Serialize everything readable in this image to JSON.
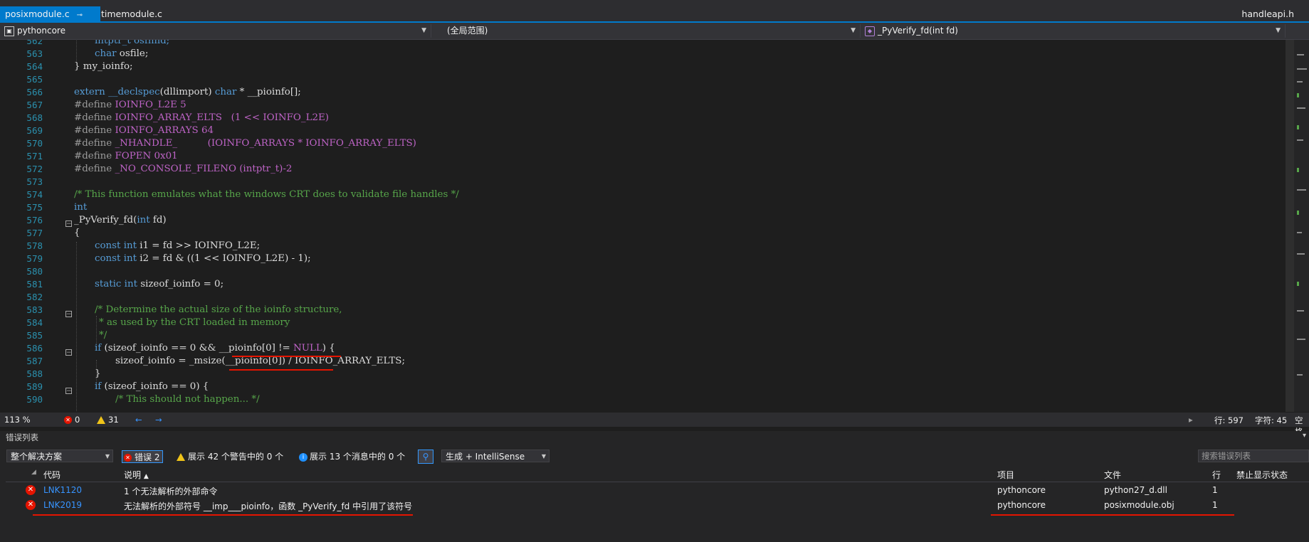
{
  "tabs": {
    "active": "posixmodule.c",
    "second": "timemodule.c",
    "right": "handleapi.h",
    "pin_glyph": "⊸",
    "close_glyph": "✕"
  },
  "navbar": {
    "project": "pythoncore",
    "scope": "(全局范围)",
    "member": "_PyVerify_fd(int fd)"
  },
  "editor": {
    "line_numbers": [
      "562",
      "563",
      "564",
      "565",
      "566",
      "567",
      "568",
      "569",
      "570",
      "571",
      "572",
      "573",
      "574",
      "575",
      "576",
      "577",
      "578",
      "579",
      "580",
      "581",
      "582",
      "583",
      "584",
      "585",
      "586",
      "587",
      "588",
      "589",
      "590"
    ],
    "code": {
      "l562": "intptr_t osfhnd;",
      "l563a": "char",
      "l563b": " osfile;",
      "l564": "} my_ioinfo;",
      "l566a": "extern",
      "l566b": "__declspec",
      "l566c": "(dllimport)",
      "l566d": "char",
      "l566e": " * __pioinfo[];",
      "define": "#define",
      "l567": "IOINFO_L2E 5",
      "l568a": "IOINFO_ARRAY_ELTS",
      "l568b": "(1 << IOINFO_L2E)",
      "l569": "IOINFO_ARRAYS 64",
      "l570a": "_NHANDLE_",
      "l570b": "(IOINFO_ARRAYS * IOINFO_ARRAY_ELTS)",
      "l571": "FOPEN 0x01",
      "l572a": "_NO_CONSOLE_FILENO",
      "l572b": " (intptr_t)-2",
      "l574": "/* This function emulates what the windows CRT does to validate file handles */",
      "l575": "int",
      "l576a": "_PyVerify_fd",
      "l576b": "(",
      "l576c": "int",
      "l576d": " fd)",
      "l577": "{",
      "const_int": "const int",
      "l578": " i1 = fd >> IOINFO_L2E;",
      "l579": " i2 = fd & ((1 << IOINFO_L2E) - 1);",
      "static_int": "static int",
      "l581": " sizeof_ioinfo = 0;",
      "l583": "/* Determine the actual size of the ioinfo structure,",
      "l584": "* as used by the CRT loaded in memory",
      "l585": "*/",
      "if": "if",
      "l586": " (sizeof_ioinfo == 0 && __pioinfo[0] != ",
      "l586null": "NULL",
      "l586end": ") {",
      "l587": "sizeof_ioinfo = _msize(__pioinfo[0]) / IOINFO_ARRAY_ELTS;",
      "l588": "}",
      "l589": " (sizeof_ioinfo == 0) {",
      "l590": "/* This should not happen... */"
    }
  },
  "status": {
    "zoom": "113 %",
    "errors": "0",
    "warnings": "31",
    "line": "行: 597",
    "char": "字符: 45",
    "spaces": "空格"
  },
  "error_list": {
    "title": "错误列表",
    "scope_dropdown": "整个解决方案",
    "errors_button": "错误 2",
    "warnings_filter": "展示 42 个警告中的 0 个",
    "messages_filter": "展示 13 个消息中的 0 个",
    "build_dropdown": "生成 + IntelliSense",
    "search_placeholder": "搜索错误列表",
    "columns": {
      "code": "代码",
      "description": "说明",
      "project": "项目",
      "file": "文件",
      "line": "行",
      "suppression": "禁止显示状态"
    },
    "rows": [
      {
        "code": "LNK1120",
        "description": "1 个无法解析的外部命令",
        "project": "pythoncore",
        "file": "python27_d.dll",
        "line": "1"
      },
      {
        "code": "LNK2019",
        "description": "无法解析的外部符号 __imp___pioinfo，函数 _PyVerify_fd 中引用了该符号",
        "project": "pythoncore",
        "file": "posixmodule.obj",
        "line": "1"
      }
    ]
  },
  "colors": {
    "accent": "#007acc",
    "error_red": "#e51400",
    "keyword": "#569cd6",
    "macro": "#bd63c5",
    "comment": "#57a64a",
    "line_number": "#2b91af",
    "link": "#3794ff"
  }
}
